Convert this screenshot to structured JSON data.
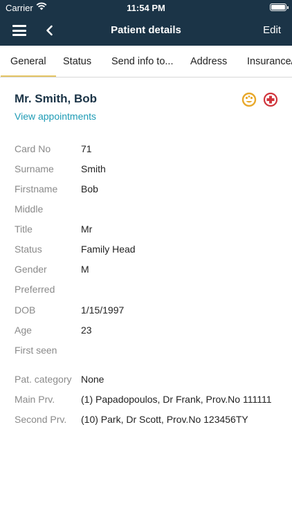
{
  "status_bar": {
    "carrier": "Carrier",
    "time": "11:54 PM"
  },
  "nav": {
    "title": "Patient details",
    "edit": "Edit"
  },
  "tabs": [
    "General",
    "Status",
    "Send info to...",
    "Address",
    "Insurance/"
  ],
  "patient": {
    "name": "Mr. Smith, Bob",
    "link": "View appointments"
  },
  "fields": [
    {
      "label": "Card No",
      "value": "71"
    },
    {
      "label": "Surname",
      "value": "Smith"
    },
    {
      "label": "Firstname",
      "value": "Bob"
    },
    {
      "label": "Middle",
      "value": ""
    },
    {
      "label": "Title",
      "value": "Mr"
    },
    {
      "label": "Status",
      "value": "Family Head"
    },
    {
      "label": "Gender",
      "value": "M"
    },
    {
      "label": "Preferred",
      "value": ""
    },
    {
      "label": "DOB",
      "value": "1/15/1997"
    },
    {
      "label": "Age",
      "value": "23"
    },
    {
      "label": "First seen",
      "value": ""
    },
    {
      "label": "Pat. category",
      "value": "None"
    },
    {
      "label": "Main Prv.",
      "value": "(1) Papadopoulos, Dr Frank, Prov.No 111111"
    },
    {
      "label": "Second Prv.",
      "value": "(10) Park, Dr Scott, Prov.No 123456TY"
    }
  ],
  "colors": {
    "header": "#1b3447",
    "accent": "#e4c463",
    "link": "#1e9bb5",
    "medical": "#d0343b",
    "face": "#e8a82a"
  }
}
